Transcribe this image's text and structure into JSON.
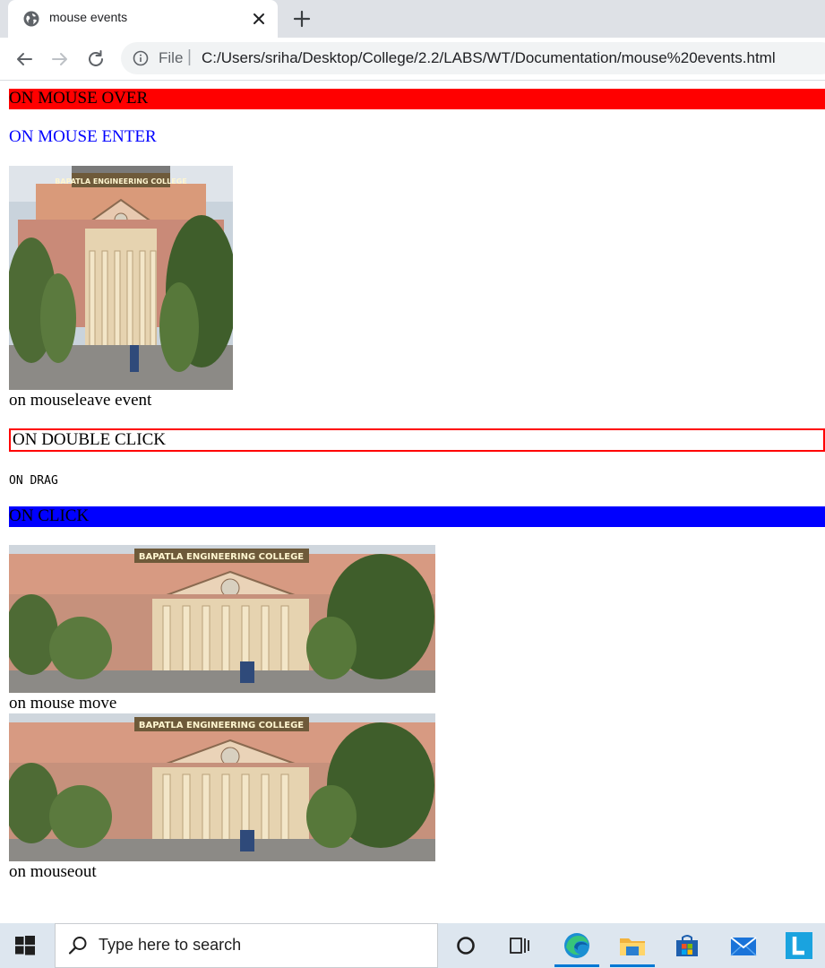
{
  "browser": {
    "tab_title": "mouse events",
    "scheme_label": "File",
    "separator": "|",
    "url": "C:/Users/sriha/Desktop/College/2.2/LABS/WT/Documentation/mouse%20events.html"
  },
  "page": {
    "mouse_over": "ON MOUSE OVER",
    "mouse_enter": "ON MOUSE ENTER",
    "mouseleave_caption": "on mouseleave event",
    "double_click": "ON DOUBLE CLICK",
    "drag": "ON DRAG",
    "click": "ON CLICK",
    "mousemove_caption": "on mouse move",
    "mouseout_caption": "on mouseout",
    "college_sign": "BAPATLA ENGINEERING COLLEGE",
    "colors": {
      "mouse_over_bg": "#ff0000",
      "mouse_enter_text": "#0000ff",
      "double_click_border": "#ff0000",
      "click_bg": "#0000ff"
    }
  },
  "taskbar": {
    "search_placeholder": "Type here to search",
    "icons": [
      "windows-start-icon",
      "search-icon",
      "cortana-icon",
      "task-view-icon",
      "edge-icon",
      "file-explorer-icon",
      "store-icon",
      "mail-icon",
      "app-l-icon"
    ]
  }
}
